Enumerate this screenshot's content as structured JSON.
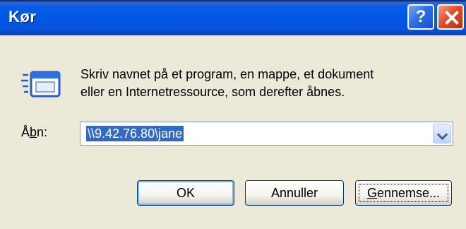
{
  "window": {
    "title": "Kør",
    "help_glyph": "?",
    "close_glyph": "×"
  },
  "description": {
    "line1": "Skriv navnet på et program, en mappe, et dokument",
    "line2": "eller en Internetressource, som derefter åbnes."
  },
  "open_field": {
    "label_prefix": "Å",
    "label_mnemonic": "b",
    "label_suffix": "n:",
    "value": "\\\\9.42.76.80\\jane"
  },
  "buttons": {
    "ok": "OK",
    "cancel": "Annuller",
    "browse_mnemonic": "G",
    "browse_rest": "ennemse..."
  },
  "icons": {
    "help": "help-icon",
    "close": "close-icon",
    "run": "run-icon",
    "dropdown": "chevron-down-icon"
  },
  "colors": {
    "titlebar": "#0058e6",
    "dialog_bg": "#ece9d8",
    "selection": "#316ac5",
    "close_red": "#e0502d"
  }
}
